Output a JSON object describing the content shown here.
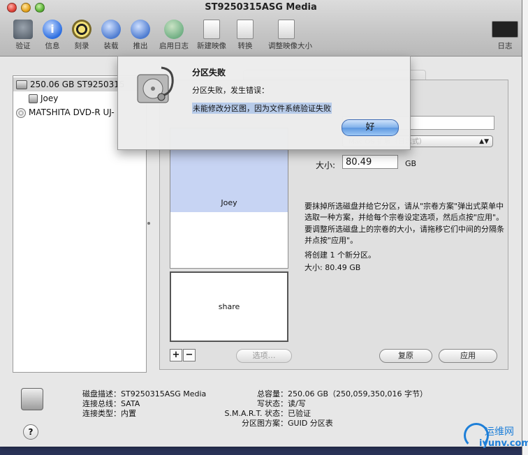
{
  "window": {
    "title": "ST9250315ASG Media"
  },
  "toolbar": {
    "items": [
      {
        "label": "验证",
        "icon": "microscope-icon"
      },
      {
        "label": "信息",
        "icon": "info-icon"
      },
      {
        "label": "刻录",
        "icon": "burn-icon"
      },
      {
        "label": "装载",
        "icon": "mount-icon"
      },
      {
        "label": "推出",
        "icon": "eject-icon"
      },
      {
        "label": "启用日志",
        "icon": "journal-icon"
      },
      {
        "label": "新建映像",
        "icon": "new-image-icon"
      },
      {
        "label": "转换",
        "icon": "convert-icon"
      },
      {
        "label": "调整映像大小",
        "icon": "resize-image-icon"
      }
    ],
    "log_label": "日志"
  },
  "sidebar": {
    "items": [
      {
        "label": "250.06 GB ST9250315",
        "type": "disk"
      },
      {
        "label": "Joey",
        "type": "volume"
      },
      {
        "label": "MATSHITA DVD-R UJ-",
        "type": "optical"
      }
    ]
  },
  "partition": {
    "volume_1": "Joey",
    "volume_2": "share",
    "add_label": "+",
    "remove_label": "−",
    "options_label": "选项…",
    "format_value": "Mac OS 扩展（日志式）",
    "size_label": "大小:",
    "size_value": "80.49",
    "size_unit": "GB",
    "help_1": "要抹掉所选磁盘并给它分区，请从\"宗卷方案\"弹出式菜单中选取一种方案，并给每个宗卷设定选项，然后点按\"应用\"。",
    "help_2": "要调整所选磁盘上的宗卷的大小，请拖移它们中间的分隔条并点按\"应用\"。",
    "summary_1": "将创建 1 个新分区。",
    "summary_2": "大小:  80.49 GB",
    "revert_label": "复原",
    "apply_label": "应用"
  },
  "dialog": {
    "title": "分区失败",
    "message": "分区失败，发生错误：",
    "detail": "未能修改分区图，因为文件系统验证失败",
    "ok_label": "好"
  },
  "disk_info": {
    "desc_key": "磁盘描述：",
    "desc_val": "ST9250315ASG Media",
    "bus_key": "连接总线：",
    "bus_val": "SATA",
    "type_key": "连接类型：",
    "type_val": "内置",
    "cap_key": "总容量：",
    "cap_val": "250.06 GB（250,059,350,016 字节）",
    "write_key": "写状态：",
    "write_val": "读/写",
    "smart_key": "S.M.A.R.T. 状态：",
    "smart_val": "已验证",
    "scheme_key": "分区图方案：",
    "scheme_val": "GUID 分区表"
  },
  "watermark": {
    "text": "运维网",
    "url": "iyunv.com"
  },
  "colors": {
    "selection": "#c7d4f3",
    "accent": "#5d97e0",
    "highlight": "#b7cbe9"
  }
}
